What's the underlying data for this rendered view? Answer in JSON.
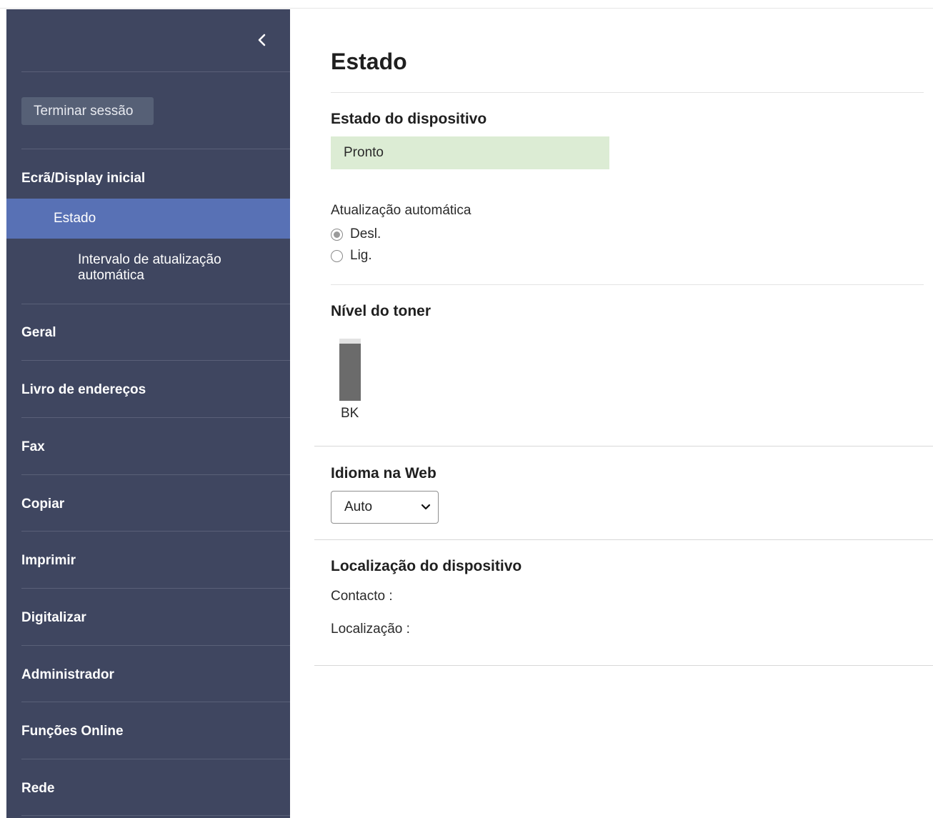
{
  "sidebar": {
    "logout_label": "Terminar sessão",
    "section_home": "Ecrã/Display inicial",
    "active_item": "Estado",
    "sub_item": "Intervalo de atualização automática",
    "nav_items": [
      "Geral",
      "Livro de endereços",
      "Fax",
      "Copiar",
      "Imprimir",
      "Digitalizar",
      "Administrador",
      "Funções Online",
      "Rede"
    ]
  },
  "main": {
    "title": "Estado",
    "device_status": {
      "title": "Estado do dispositivo",
      "value": "Pronto"
    },
    "auto_refresh": {
      "label": "Atualização automática",
      "options": [
        "Desl.",
        "Lig."
      ],
      "selected": "Desl."
    },
    "toner": {
      "title": "Nível do toner",
      "label": "BK",
      "level_fraction": 0.92
    },
    "web_language": {
      "title": "Idioma na Web",
      "selected": "Auto"
    },
    "location": {
      "title": "Localização do dispositivo",
      "contact_label": "Contacto :",
      "location_label": "Localização :"
    }
  },
  "colors": {
    "sidebar_bg": "#3f4660",
    "sidebar_active": "#5871b5",
    "status_bg": "#dcecd4",
    "toner_fill": "#6b6b6b"
  }
}
